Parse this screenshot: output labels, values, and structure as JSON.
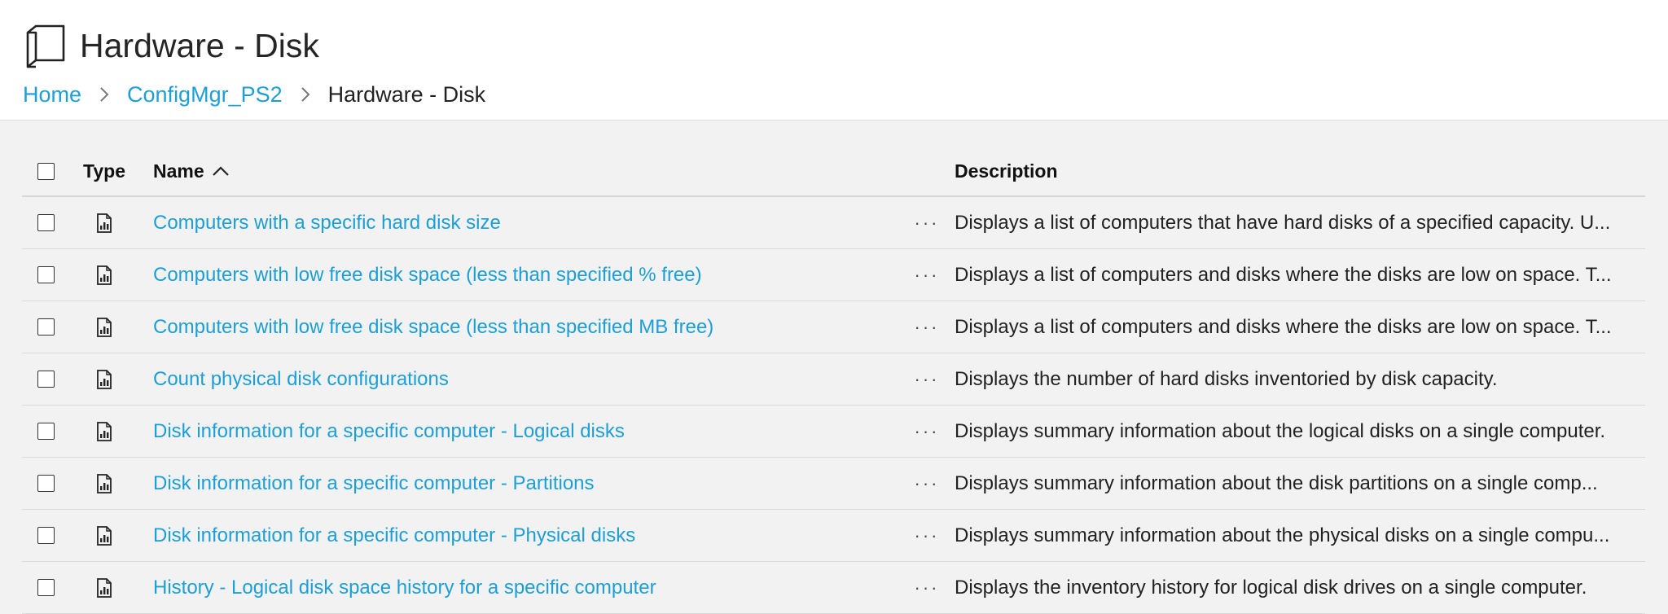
{
  "header": {
    "title": "Hardware - Disk",
    "icon": "report-folder-icon"
  },
  "breadcrumb": {
    "items": [
      "Home",
      "ConfigMgr_PS2"
    ],
    "current": "Hardware - Disk",
    "separator_icon": "chevron-right-icon"
  },
  "columns": {
    "type": "Type",
    "name": "Name",
    "description": "Description",
    "sort_icon": "sort-ascending-icon"
  },
  "rows": [
    {
      "name": "Computers with a specific hard disk size",
      "more": "···",
      "description": "Displays a list of computers that have hard disks of a specified capacity. U..."
    },
    {
      "name": "Computers with low free disk space (less than specified % free)",
      "more": "···",
      "description": "Displays a list of computers and disks where the disks are low on space. T..."
    },
    {
      "name": "Computers with low free disk space (less than specified MB free)",
      "more": "···",
      "description": "Displays a list of computers and disks where the disks are low on space. T..."
    },
    {
      "name": "Count physical disk configurations",
      "more": "···",
      "description": "Displays the number of hard disks inventoried by disk capacity."
    },
    {
      "name": "Disk information for a specific computer - Logical disks",
      "more": "···",
      "description": "Displays summary information about the logical disks on a single computer."
    },
    {
      "name": "Disk information for a specific computer - Partitions",
      "more": "···",
      "description": "Displays summary information about the disk partitions on a single comp..."
    },
    {
      "name": "Disk information for a specific computer - Physical disks",
      "more": "···",
      "description": "Displays summary information about the physical disks on a single compu..."
    },
    {
      "name": "History - Logical disk space history for a specific computer",
      "more": "···",
      "description": "Displays the inventory history for logical disk drives on a single computer."
    }
  ],
  "colors": {
    "link": "#1d9fd6",
    "background": "#f2f2f2",
    "header_background": "#ffffff"
  }
}
